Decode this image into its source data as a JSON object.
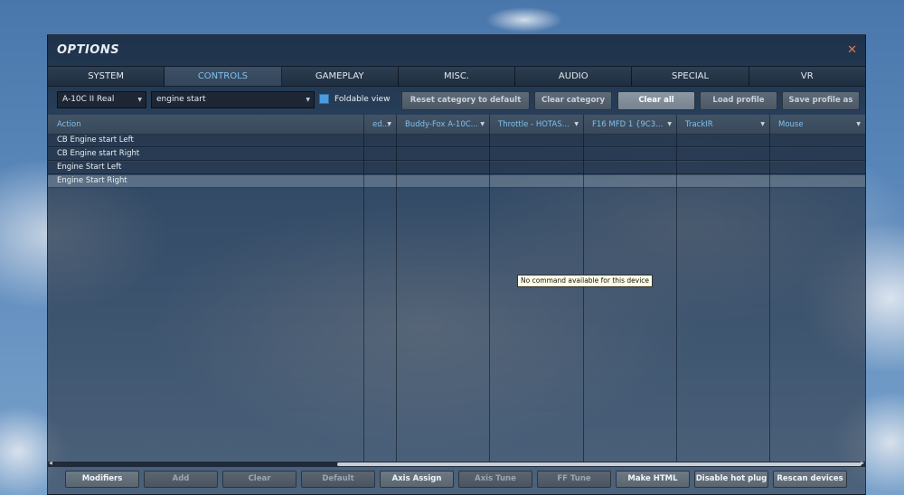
{
  "window": {
    "title": "OPTIONS",
    "close_icon": "✕"
  },
  "tabs": [
    {
      "label": "SYSTEM",
      "active": false
    },
    {
      "label": "CONTROLS",
      "active": true
    },
    {
      "label": "GAMEPLAY",
      "active": false
    },
    {
      "label": "MISC.",
      "active": false
    },
    {
      "label": "AUDIO",
      "active": false
    },
    {
      "label": "SPECIAL",
      "active": false
    },
    {
      "label": "VR",
      "active": false
    }
  ],
  "toolbar": {
    "aircraft_select": "A-10C II Real",
    "search_value": "engine start",
    "foldable_view_label": "Foldable view",
    "foldable_view_checked": true,
    "reset_category_label": "Reset category to default",
    "clear_category_label": "Clear category",
    "clear_all_label": "Clear all",
    "load_profile_label": "Load profile",
    "save_profile_label": "Save profile as"
  },
  "grid": {
    "columns": [
      "Action",
      "ed...",
      "Buddy-Fox A-10C...",
      "Throttle - HOTAS...",
      "F16 MFD 1 {9C3...",
      "TrackIR",
      "Mouse"
    ],
    "rows": [
      "CB Engine start Left",
      "CB Engine start Right",
      "Engine Start Left",
      "Engine Start Right"
    ],
    "selected_row": 3,
    "tooltip": "No command available for this device"
  },
  "bottom_buttons": [
    {
      "label": "Modifiers",
      "enabled": true
    },
    {
      "label": "Add",
      "enabled": false
    },
    {
      "label": "Clear",
      "enabled": false
    },
    {
      "label": "Default",
      "enabled": false
    },
    {
      "label": "Axis Assign",
      "enabled": true
    },
    {
      "label": "Axis Tune",
      "enabled": false
    },
    {
      "label": "FF Tune",
      "enabled": false
    },
    {
      "label": "Make HTML",
      "enabled": true
    },
    {
      "label": "Disable hot plug",
      "enabled": true
    },
    {
      "label": "Rescan devices",
      "enabled": true
    }
  ],
  "icons": {
    "dropdown_arrow": "▼",
    "scroll_left": "◀",
    "scroll_right": "▶"
  },
  "colors": {
    "accent_blue": "#7fc0ea",
    "close_orange": "#d97a55",
    "checkbox_blue": "#4a9be0"
  }
}
